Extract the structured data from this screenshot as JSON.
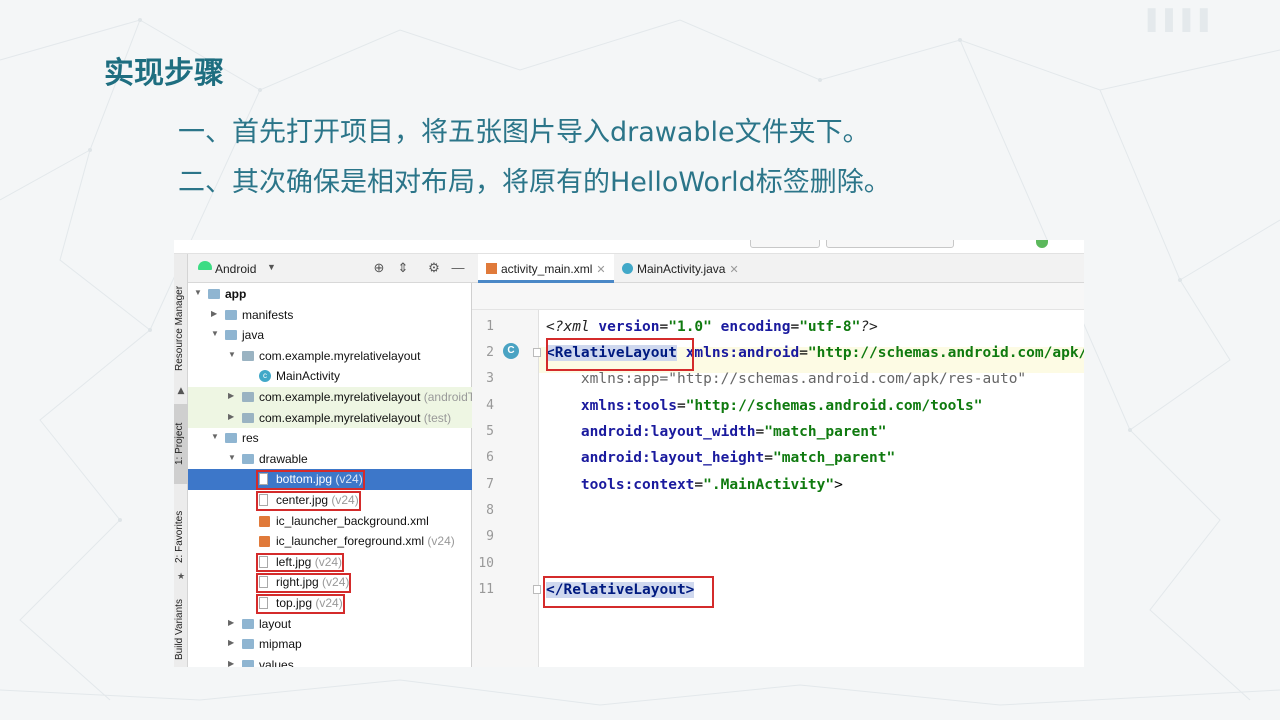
{
  "slide": {
    "title": "实现步骤",
    "steps": [
      "一、首先打开项目，将五张图片导入drawable文件夹下。",
      "二、其次确保是相对布局，将原有的HelloWorld标签删除。"
    ]
  },
  "sidebar_tabs": [
    "Resource Manager",
    "1: Project",
    "2: Favorites",
    "Build Variants"
  ],
  "project_panel": {
    "view_label": "Android",
    "tree": [
      {
        "label": "app",
        "indent": 0,
        "icon": "folder-icon",
        "bold": true
      },
      {
        "label": "manifests",
        "indent": 1,
        "icon": "folder-icon"
      },
      {
        "label": "java",
        "indent": 1,
        "icon": "folder-icon"
      },
      {
        "label": "com.example.myrelativelayout",
        "indent": 2,
        "icon": "package-icon"
      },
      {
        "label": "MainActivity",
        "indent": 3,
        "icon": "class-icon"
      },
      {
        "label": "com.example.myrelativelayout",
        "suffix": "(androidTest)",
        "indent": 2,
        "icon": "package-icon",
        "green": true
      },
      {
        "label": "com.example.myrelativelayout",
        "suffix": "(test)",
        "indent": 2,
        "icon": "package-icon",
        "green": true
      },
      {
        "label": "res",
        "indent": 1,
        "icon": "folder-icon"
      },
      {
        "label": "drawable",
        "indent": 2,
        "icon": "folder-icon"
      },
      {
        "label": "bottom.jpg",
        "suffix": "(v24)",
        "indent": 3,
        "icon": "image-file-icon",
        "selected": true,
        "boxed": true
      },
      {
        "label": "center.jpg",
        "suffix": "(v24)",
        "indent": 3,
        "icon": "image-file-icon",
        "boxed": true
      },
      {
        "label": "ic_launcher_background.xml",
        "indent": 3,
        "icon": "xml-file-icon"
      },
      {
        "label": "ic_launcher_foreground.xml",
        "suffix": "(v24)",
        "indent": 3,
        "icon": "xml-file-icon"
      },
      {
        "label": "left.jpg",
        "suffix": "(v24)",
        "indent": 3,
        "icon": "image-file-icon",
        "boxed": true
      },
      {
        "label": "right.jpg",
        "suffix": "(v24)",
        "indent": 3,
        "icon": "image-file-icon",
        "boxed": true
      },
      {
        "label": "top.jpg",
        "suffix": "(v24)",
        "indent": 3,
        "icon": "image-file-icon",
        "boxed": true
      },
      {
        "label": "layout",
        "indent": 2,
        "icon": "folder-icon"
      },
      {
        "label": "mipmap",
        "indent": 2,
        "icon": "folder-icon"
      },
      {
        "label": "values",
        "indent": 2,
        "icon": "folder-icon"
      }
    ]
  },
  "editor": {
    "tabs": [
      {
        "label": "activity_main.xml",
        "active": true,
        "icon": "xml-file-icon"
      },
      {
        "label": "MainActivity.java",
        "active": false,
        "icon": "class-icon"
      }
    ],
    "line_numbers": [
      "1",
      "2",
      "3",
      "4",
      "5",
      "6",
      "7",
      "8",
      "9",
      "10",
      "11"
    ],
    "code": {
      "l1_open": "<?xml ",
      "l1_a1": "version",
      "l1_v1": "\"1.0\"",
      "l1_a2": "encoding",
      "l1_v2": "\"utf-8\"",
      "l1_close": "?>",
      "l2_tag": "<RelativeLayout",
      "l2_attr": "xmlns:android",
      "l2_val": "\"http://schemas.android.com/apk/res/android\"",
      "l3_attr": "xmlns:app",
      "l3_val": "\"http://schemas.android.com/apk/res-auto\"",
      "l4_attr": "xmlns:tools",
      "l4_val": "\"http://schemas.android.com/tools\"",
      "l5_attr": "android:layout_width",
      "l5_val": "\"match_parent\"",
      "l6_attr": "android:layout_height",
      "l6_val": "\"match_parent\"",
      "l7_attr": "tools:context",
      "l7_val": "\".MainActivity\"",
      "l7_end": ">",
      "l11_tag": "</RelativeLayout>",
      "eq": "="
    }
  },
  "colors": {
    "title": "#1e6e80",
    "step_text": "#2b7589",
    "selection": "#3d77c9",
    "highlight_box": "#d42b2b",
    "xml_tag": "#001a80",
    "xml_value": "#0f7a0f"
  }
}
